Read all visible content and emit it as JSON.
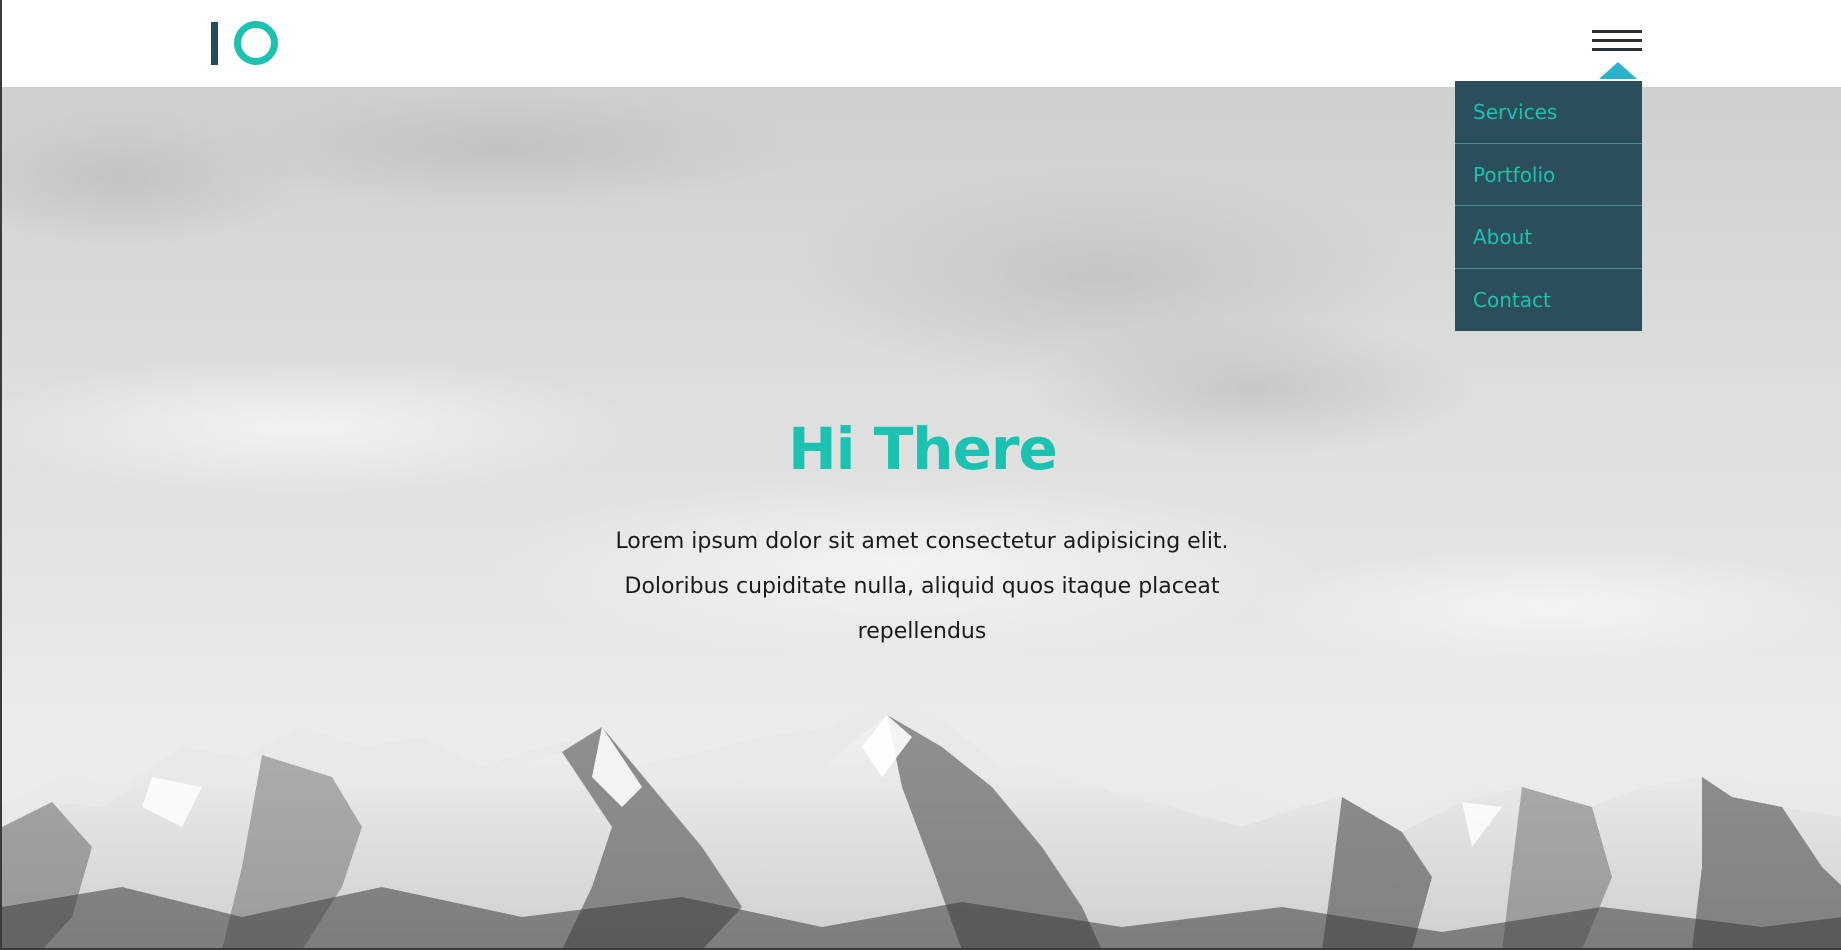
{
  "header": {
    "logo": "logo",
    "menu_icon": "hamburger-menu-icon"
  },
  "nav": {
    "items": [
      {
        "label": "Services"
      },
      {
        "label": "Portfolio"
      },
      {
        "label": "About"
      },
      {
        "label": "Contact"
      }
    ]
  },
  "hero": {
    "title": "Hi There",
    "text": "Lorem ipsum dolor sit amet consectetur adipisicing elit. Doloribus cupiditate nulla, aliquid quos itaque placeat repellendus"
  },
  "colors": {
    "accent": "#1cc2b0",
    "dropdown_bg": "#2a4f5a",
    "caret": "#29b2c8",
    "logo_dark": "#1f4e56",
    "text_dark": "#1b1b1b"
  }
}
